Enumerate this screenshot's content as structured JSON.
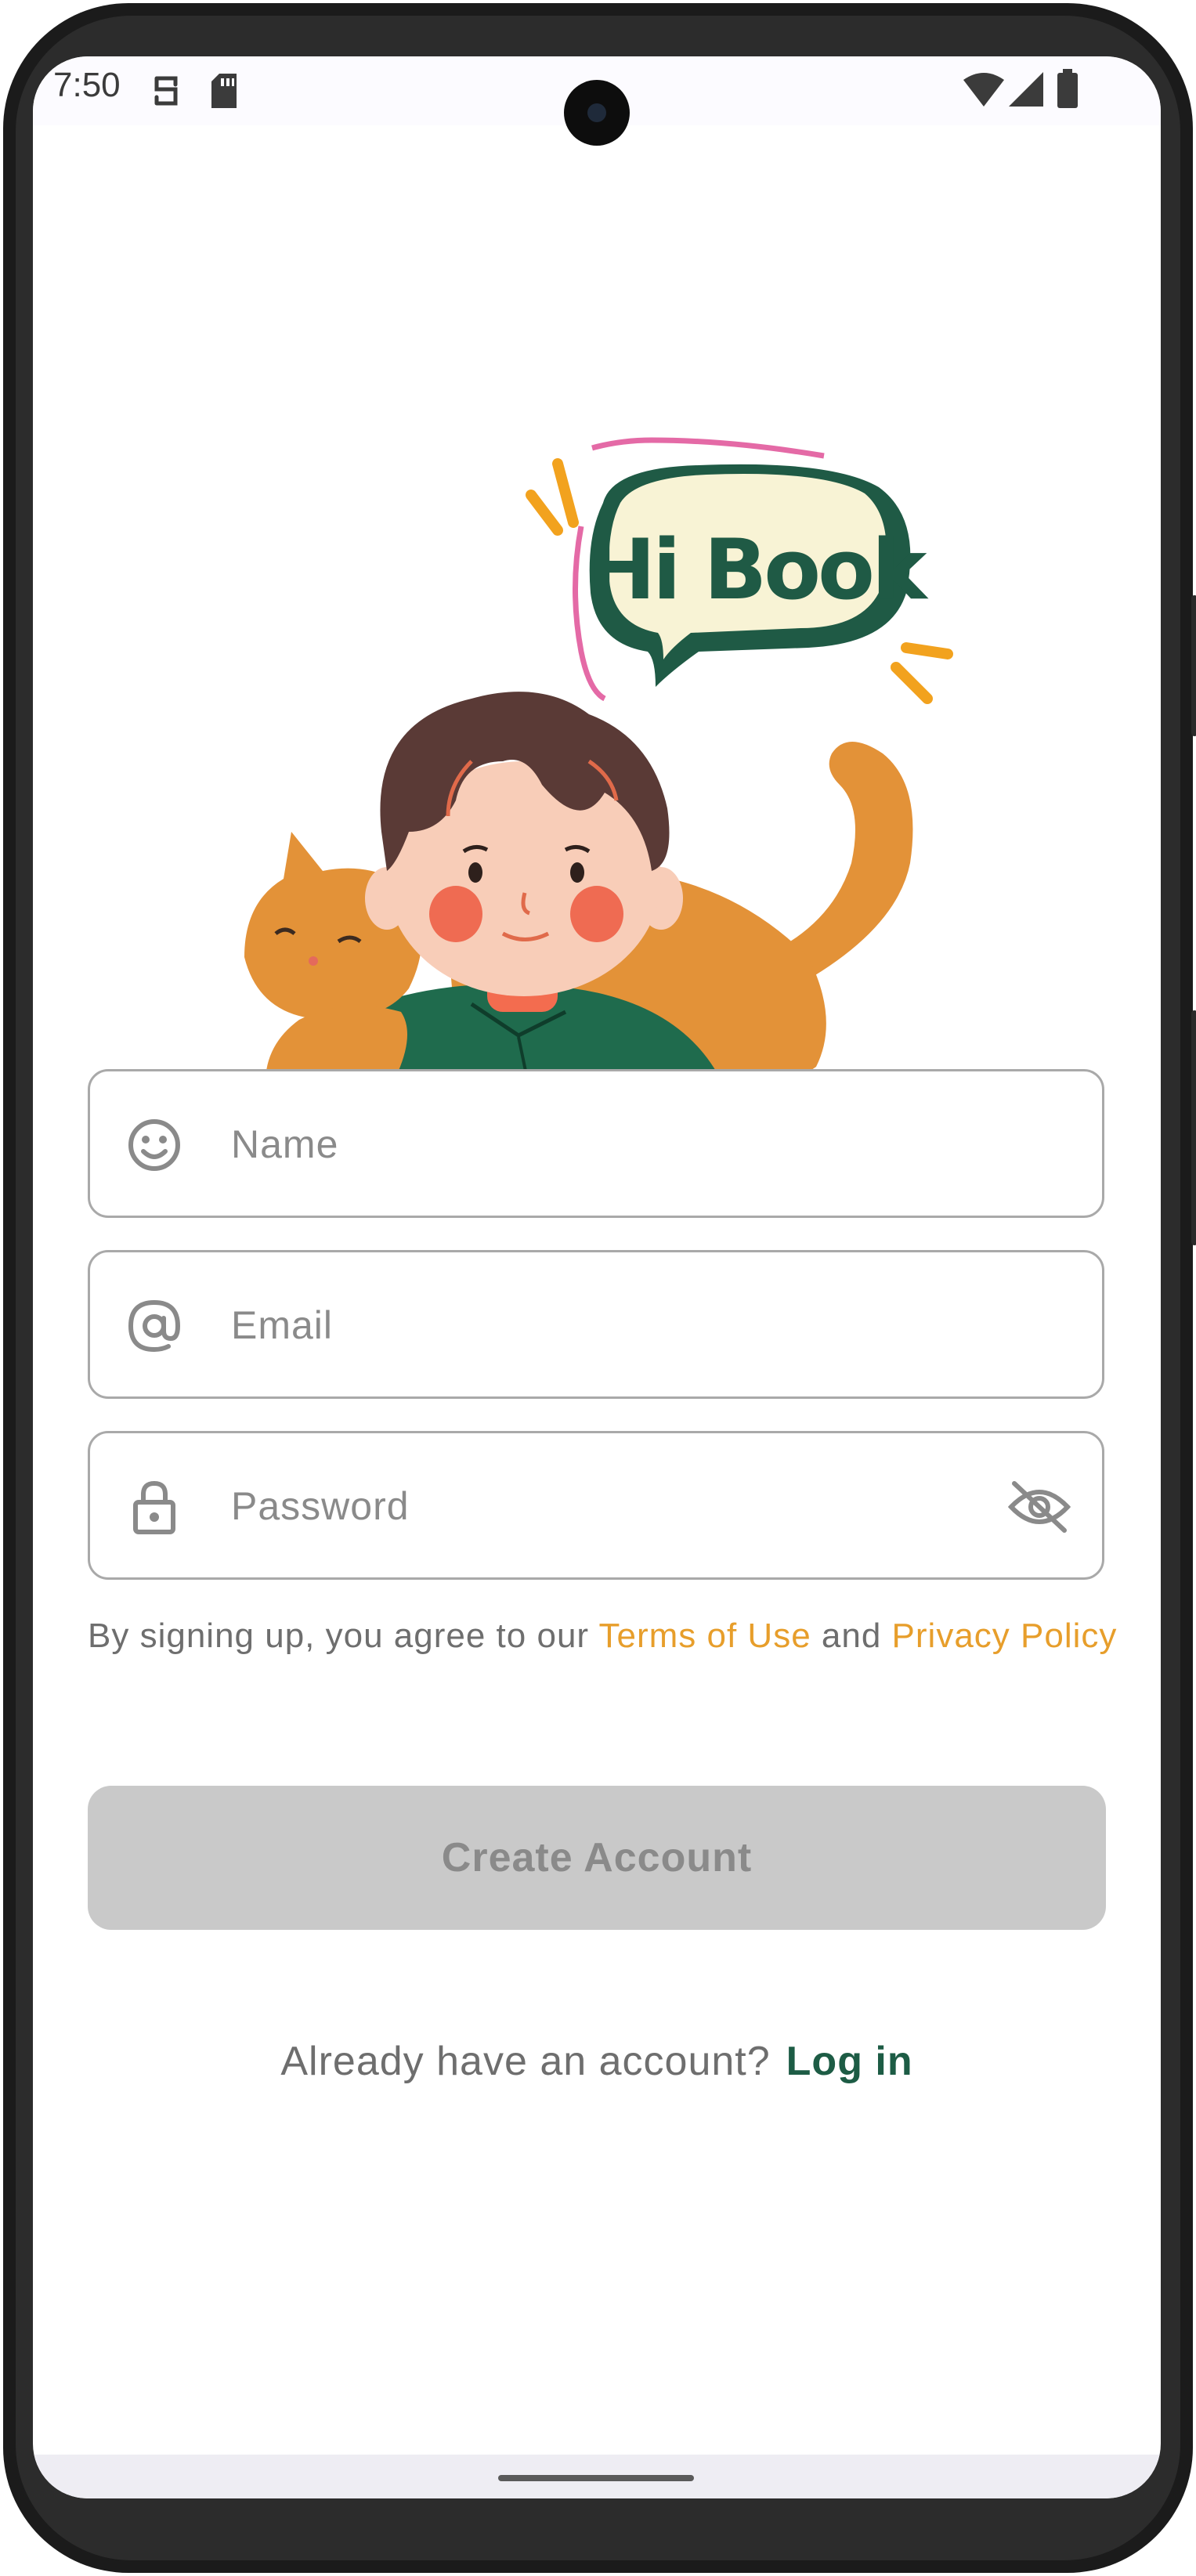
{
  "status_bar": {
    "time": "7:50",
    "left_icons": [
      "vpn-key-icon",
      "sd-card-icon"
    ],
    "right_icons": [
      "wifi-icon",
      "signal-icon",
      "battery-icon"
    ]
  },
  "hero": {
    "speech_bubble_text": "Hi Book",
    "illustration": "boy-with-cat-illustration"
  },
  "form": {
    "name": {
      "placeholder": "Name",
      "value": "",
      "icon": "smiley-icon"
    },
    "email": {
      "placeholder": "Email",
      "value": "",
      "icon": "at-sign-icon"
    },
    "password": {
      "placeholder": "Password",
      "value": "",
      "icon": "lock-icon",
      "toggle_icon": "eye-off-icon"
    }
  },
  "terms": {
    "prefix": "By signing up, you agree to our ",
    "terms_link": "Terms of Use",
    "middle": " and ",
    "privacy_link": "Privacy Policy"
  },
  "create_button": {
    "label": "Create Account",
    "enabled": false
  },
  "login": {
    "prompt": "Already have an account?",
    "link": "Log in"
  },
  "colors": {
    "accent_orange": "#e79e2b",
    "brand_green": "#1d5c45",
    "disabled_button": "#c9c9c9",
    "field_border": "#a9a9a9"
  }
}
